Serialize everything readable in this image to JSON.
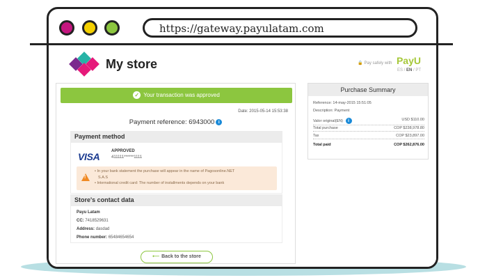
{
  "browser": {
    "url": "https://gateway.payulatam.com"
  },
  "header": {
    "store_name": "My store",
    "pay_safe_text": "🔒 Pay safely with",
    "pay_brand": "PayU",
    "lang_es": "ES",
    "lang_en": "EN",
    "lang_pt": "PT",
    "lang_sep": "/"
  },
  "transaction": {
    "status_message": "Your transaction was approved",
    "date": "Date: 2015-05-14  15:53:38",
    "payment_reference": "Payment reference: 6943000"
  },
  "payment_method": {
    "title": "Payment method",
    "card_brand": "VISA",
    "status": "APPROVED",
    "card_number": "411111******1111",
    "notices": [
      "In your bank statement the purchase will appear in the name of Pagosonline.NET",
      "S.A.S",
      "International credit card: The number of installments depends on your bank"
    ]
  },
  "contact": {
    "title": "Store's contact data",
    "name": "Payu Latam",
    "cc_label": "CC:",
    "cc_value": "7418529631",
    "address_label": "Address:",
    "address_value": "dasdad",
    "phone_label": "Phone number:",
    "phone_value": "65484654654"
  },
  "back_button": "Back to the store",
  "summary": {
    "title": "Purchase Summary",
    "reference": "Reference: 14-may-2015 15:51:05",
    "description": "Description: Payment",
    "rows": [
      {
        "label": "Valor original(EN)",
        "value": "USD $110.00"
      },
      {
        "label": "Total purchase",
        "value": "COP $238,978.80"
      },
      {
        "label": "Tax",
        "value": "COP $23,897.00"
      },
      {
        "label": "Total paid",
        "value": "COP $262,876.00"
      }
    ]
  },
  "colors": {
    "accent_green": "#8cc63f",
    "logo_purple": "#7b2a8e",
    "logo_pink": "#e6197a",
    "logo_teal": "#27b3a6",
    "payu_green": "#a6c839",
    "window_dot_red": "#c4167f",
    "window_dot_yellow": "#f4d000",
    "window_dot_green": "#8cc63f"
  }
}
